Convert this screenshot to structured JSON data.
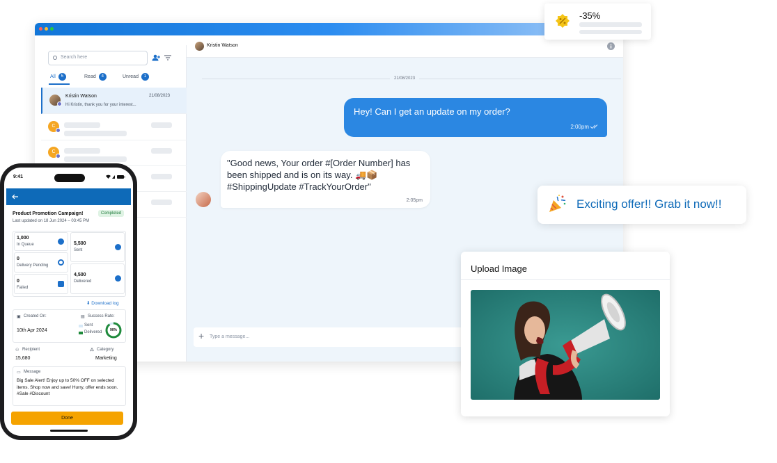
{
  "promo": {
    "discount": "-35%",
    "icon": "percent-badge-icon",
    "accent": "#f5c518"
  },
  "sidebar": {
    "search_placeholder": "Search here",
    "tabs": [
      {
        "label": "All",
        "count": "5"
      },
      {
        "label": "Read",
        "count": "4"
      },
      {
        "label": "Unread",
        "count": "1"
      }
    ],
    "contacts": [
      {
        "name": "Kristin Watson",
        "date": "21/08/2023",
        "preview": "Hi Kristin, thank you for your interest...",
        "initial": ""
      },
      {
        "initial": "C"
      },
      {
        "initial": "C"
      }
    ]
  },
  "chat": {
    "contact_name": "Kristin Watson",
    "date_divider": "21/08/2023",
    "outgoing": {
      "text": "Hey! Can I get an update on my order?",
      "time": "2:00pm"
    },
    "incoming": {
      "text": "\"Good news, Your order #[Order Number] has been shipped and is on its way. 🚚📦 #ShippingUpdate #TrackYourOrder\"",
      "time": "2:05pm"
    },
    "input_placeholder": "Type a message..."
  },
  "offer": {
    "text": "Exciting offer!! Grab it now!!",
    "icon": "party-popper-icon",
    "color": "#0e6ab8"
  },
  "upload": {
    "title": "Upload Image"
  },
  "phone": {
    "time": "9:41",
    "campaign_title": "Product Promotion Campaign!",
    "status": "Completed",
    "last_updated": "Last updated on 18 Jun 2024 – 03:45 PM",
    "stats": [
      {
        "value": "1,000",
        "label": "In Queue"
      },
      {
        "value": "5,500",
        "label": "Sent"
      },
      {
        "value": "0",
        "label": "Delivery Pending"
      },
      {
        "value": "0",
        "label": "Failed"
      },
      {
        "value": "4,500",
        "label": "Delivered"
      }
    ],
    "download_label": "Download log",
    "created_on_label": "Created On:",
    "created_on": "10th Apr 2024",
    "success_rate_label": "Success Rate:",
    "legend_sent": "Sent",
    "legend_delivered": "Delivered",
    "success_rate": "90%",
    "success_fraction": 0.9,
    "recipient_label": "Recipient",
    "recipient": "15,680",
    "category_label": "Category",
    "category": "Marketing",
    "message_label": "Message",
    "message": "Big Sale Alert! Enjoy up to 50% OFF on selected items. Shop now and save! Hurry, offer ends soon. #Sale #Discount",
    "done_label": "Done"
  }
}
